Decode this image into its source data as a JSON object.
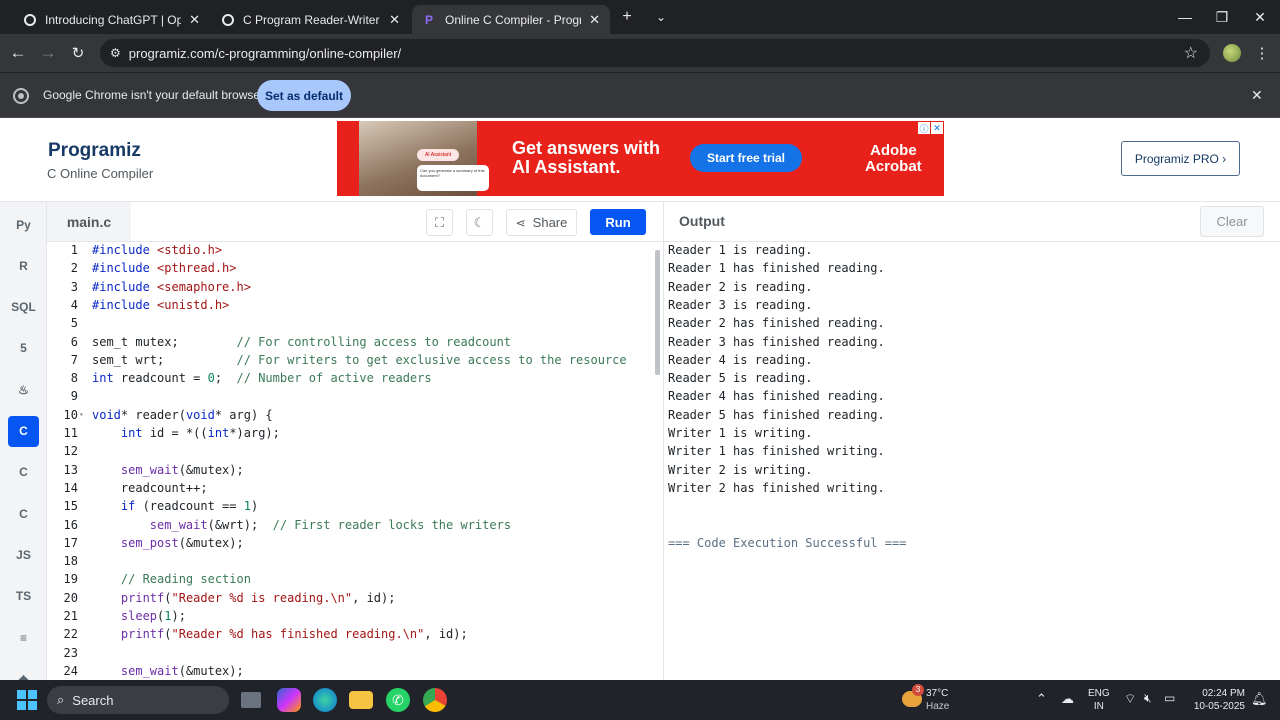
{
  "browser": {
    "tabs": [
      {
        "title": "Introducing ChatGPT | OpenAI",
        "active": false
      },
      {
        "title": "C Program Reader-Writer Sema",
        "active": false
      },
      {
        "title": "Online C Compiler - Programiz",
        "active": true
      }
    ],
    "url": "programiz.com/c-programming/online-compiler/",
    "infobar": {
      "message": "Google Chrome isn't your default browser",
      "button": "Set as default"
    }
  },
  "site": {
    "logo": "Programiz",
    "subtitle": "C Online Compiler",
    "pro_button": "Programiz PRO ›",
    "ad": {
      "pill": "AI Assistant",
      "bubble": "Can you generate a summary of this document?",
      "headline": "Get answers with AI Assistant.",
      "cta": "Start free trial",
      "brand_line1": "Adobe",
      "brand_line2": "Acrobat"
    }
  },
  "sidebar": {
    "items": [
      {
        "icon": "python-icon",
        "label": "Py",
        "active": false
      },
      {
        "icon": "r-icon",
        "label": "R",
        "active": false
      },
      {
        "icon": "database-icon",
        "label": "SQL",
        "active": false
      },
      {
        "icon": "html5-icon",
        "label": "5",
        "active": false
      },
      {
        "icon": "java-icon",
        "label": "♨",
        "active": false
      },
      {
        "icon": "c-icon",
        "label": "C",
        "active": true
      },
      {
        "icon": "cpp-icon",
        "label": "C",
        "active": false
      },
      {
        "icon": "csharp-icon",
        "label": "C",
        "active": false
      },
      {
        "icon": "js-icon",
        "label": "JS",
        "active": false
      },
      {
        "icon": "ts-icon",
        "label": "TS",
        "active": false
      },
      {
        "icon": "go-icon",
        "label": "≡",
        "active": false
      },
      {
        "icon": "php-icon",
        "label": "◆",
        "active": false
      }
    ]
  },
  "editor": {
    "filename": "main.c",
    "share_label": "Share",
    "run_label": "Run",
    "lines": [
      {
        "n": "1",
        "t": "#include <stdio.h>"
      },
      {
        "n": "2",
        "t": "#include <pthread.h>"
      },
      {
        "n": "3",
        "t": "#include <semaphore.h>"
      },
      {
        "n": "4",
        "t": "#include <unistd.h>"
      },
      {
        "n": "5",
        "t": ""
      },
      {
        "n": "6",
        "t": "sem_t mutex;        // For controlling access to readcount"
      },
      {
        "n": "7",
        "t": "sem_t wrt;          // For writers to get exclusive access to the resource"
      },
      {
        "n": "8",
        "t": "int readcount = 0;  // Number of active readers"
      },
      {
        "n": "9",
        "t": ""
      },
      {
        "n": "10",
        "t": "void* reader(void* arg) {",
        "fold": true
      },
      {
        "n": "11",
        "t": "    int id = *((int*)arg);"
      },
      {
        "n": "12",
        "t": ""
      },
      {
        "n": "13",
        "t": "    sem_wait(&mutex);"
      },
      {
        "n": "14",
        "t": "    readcount++;"
      },
      {
        "n": "15",
        "t": "    if (readcount == 1)"
      },
      {
        "n": "16",
        "t": "        sem_wait(&wrt);  // First reader locks the writers"
      },
      {
        "n": "17",
        "t": "    sem_post(&mutex);"
      },
      {
        "n": "18",
        "t": ""
      },
      {
        "n": "19",
        "t": "    // Reading section"
      },
      {
        "n": "20",
        "t": "    printf(\"Reader %d is reading.\\n\", id);"
      },
      {
        "n": "21",
        "t": "    sleep(1);"
      },
      {
        "n": "22",
        "t": "    printf(\"Reader %d has finished reading.\\n\", id);"
      },
      {
        "n": "23",
        "t": ""
      },
      {
        "n": "24",
        "t": "    sem_wait(&mutex);"
      }
    ]
  },
  "output": {
    "title": "Output",
    "clear_label": "Clear",
    "lines": [
      "Reader 1 is reading.",
      "Reader 1 has finished reading.",
      "Reader 2 is reading.",
      "Reader 3 is reading.",
      "Reader 2 has finished reading.",
      "Reader 3 has finished reading.",
      "Reader 4 is reading.",
      "Reader 5 is reading.",
      "Reader 4 has finished reading.",
      "Reader 5 has finished reading.",
      "Writer 1 is writing.",
      "Writer 1 has finished writing.",
      "Writer 2 is writing.",
      "Writer 2 has finished writing."
    ],
    "status": "=== Code Execution Successful ==="
  },
  "taskbar": {
    "search_label": "Search",
    "weather_temp": "37°C",
    "weather_desc": "Haze",
    "weather_badge": "3",
    "lang1": "ENG",
    "lang2": "IN",
    "time": "02:24 PM",
    "date": "10-05-2025"
  },
  "colors": {
    "accent": "#0556f3",
    "chrome_dark": "#202124",
    "ad_red": "#e8211a",
    "keyword": "#0a28c8",
    "string": "#a31515",
    "comment": "#3b7a57"
  }
}
